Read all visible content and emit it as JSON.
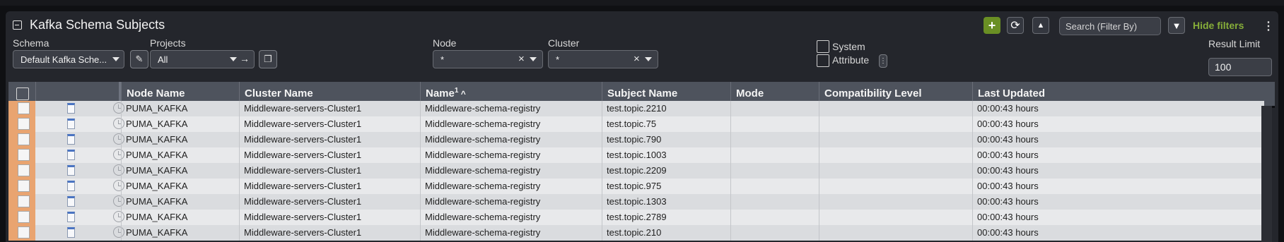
{
  "panel": {
    "title": "Kafka Schema Subjects",
    "search_placeholder": "Search (Filter By)",
    "hide_filters_label": "Hide filters",
    "accent_color": "#6a8f24"
  },
  "filters": {
    "schema_label": "Schema",
    "schema_value": "Default Kafka Sche...",
    "projects_label": "Projects",
    "projects_value": "All",
    "node_label": "Node",
    "node_value": "*",
    "cluster_label": "Cluster",
    "cluster_value": "*",
    "system_label": "System",
    "attribute_label": "Attribute",
    "result_limit_label": "Result Limit",
    "result_limit_value": "100"
  },
  "table": {
    "columns": {
      "node_name": "Node Name",
      "cluster_name": "Cluster Name",
      "name": "Name",
      "name_sort_index": "1",
      "subject_name": "Subject Name",
      "mode": "Mode",
      "compatibility_level": "Compatibility Level",
      "last_updated": "Last Updated"
    },
    "rows": [
      {
        "node": "PUMA_KAFKA",
        "cluster": "Middleware-servers-Cluster1",
        "name": "Middleware-schema-registry",
        "subject": "test.topic.2210",
        "mode": "",
        "compat": "",
        "updated": "00:00:43 hours"
      },
      {
        "node": "PUMA_KAFKA",
        "cluster": "Middleware-servers-Cluster1",
        "name": "Middleware-schema-registry",
        "subject": "test.topic.75",
        "mode": "",
        "compat": "",
        "updated": "00:00:43 hours"
      },
      {
        "node": "PUMA_KAFKA",
        "cluster": "Middleware-servers-Cluster1",
        "name": "Middleware-schema-registry",
        "subject": "test.topic.790",
        "mode": "",
        "compat": "",
        "updated": "00:00:43 hours"
      },
      {
        "node": "PUMA_KAFKA",
        "cluster": "Middleware-servers-Cluster1",
        "name": "Middleware-schema-registry",
        "subject": "test.topic.1003",
        "mode": "",
        "compat": "",
        "updated": "00:00:43 hours"
      },
      {
        "node": "PUMA_KAFKA",
        "cluster": "Middleware-servers-Cluster1",
        "name": "Middleware-schema-registry",
        "subject": "test.topic.2209",
        "mode": "",
        "compat": "",
        "updated": "00:00:43 hours"
      },
      {
        "node": "PUMA_KAFKA",
        "cluster": "Middleware-servers-Cluster1",
        "name": "Middleware-schema-registry",
        "subject": "test.topic.975",
        "mode": "",
        "compat": "",
        "updated": "00:00:43 hours"
      },
      {
        "node": "PUMA_KAFKA",
        "cluster": "Middleware-servers-Cluster1",
        "name": "Middleware-schema-registry",
        "subject": "test.topic.1303",
        "mode": "",
        "compat": "",
        "updated": "00:00:43 hours"
      },
      {
        "node": "PUMA_KAFKA",
        "cluster": "Middleware-servers-Cluster1",
        "name": "Middleware-schema-registry",
        "subject": "test.topic.2789",
        "mode": "",
        "compat": "",
        "updated": "00:00:43 hours"
      },
      {
        "node": "PUMA_KAFKA",
        "cluster": "Middleware-servers-Cluster1",
        "name": "Middleware-schema-registry",
        "subject": "test.topic.210",
        "mode": "",
        "compat": "",
        "updated": "00:00:43 hours"
      }
    ]
  }
}
